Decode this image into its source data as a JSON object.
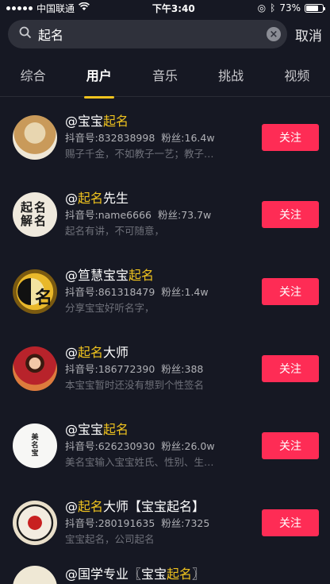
{
  "status_bar": {
    "carrier": "中国联通",
    "time": "下午3:40",
    "battery": "73%",
    "battery_level": 0.73
  },
  "search": {
    "query": "起名",
    "cancel_label": "取消"
  },
  "tabs": [
    {
      "label": "综合",
      "active": false
    },
    {
      "label": "用户",
      "active": true
    },
    {
      "label": "音乐",
      "active": false
    },
    {
      "label": "挑战",
      "active": false
    },
    {
      "label": "视频",
      "active": false
    }
  ],
  "users": [
    {
      "name_pre": "@宝宝",
      "name_hl": "起名",
      "name_post": "",
      "id_label": "抖音号:832838998",
      "fans_label": "粉丝:16.4w",
      "bio": "赐子千金，不如教子一艺；教子…",
      "avatar_text": "",
      "follow_label": "关注"
    },
    {
      "name_pre": "@",
      "name_hl": "起名",
      "name_post": "先生",
      "id_label": "抖音号:name6666",
      "fans_label": "粉丝:73.7w",
      "bio": "起名有讲，不可随意，",
      "avatar_text": "起名解名",
      "follow_label": "关注"
    },
    {
      "name_pre": "@笪慧宝宝",
      "name_hl": "起名",
      "name_post": "",
      "id_label": "抖音号:861318479",
      "fans_label": "粉丝:1.4w",
      "bio": "分享宝宝好听名字，",
      "avatar_text": "名",
      "follow_label": "关注"
    },
    {
      "name_pre": "@",
      "name_hl": "起名",
      "name_post": "大师",
      "id_label": "抖音号:186772390",
      "fans_label": "粉丝:388",
      "bio": "本宝宝暂时还没有想到个性签名",
      "avatar_text": "",
      "follow_label": "关注"
    },
    {
      "name_pre": "@宝宝",
      "name_hl": "起名",
      "name_post": "",
      "id_label": "抖音号:626230930",
      "fans_label": "粉丝:26.0w",
      "bio": "美名宝输入宝宝姓氏、性别、生…",
      "avatar_text": "美名宝",
      "follow_label": "关注"
    },
    {
      "name_pre": "@",
      "name_hl": "起名",
      "name_post": "大师【宝宝起名】",
      "id_label": "抖音号:280191635",
      "fans_label": "粉丝:7325",
      "bio": "宝宝起名，公司起名",
      "avatar_text": "",
      "follow_label": "关注"
    },
    {
      "name_pre": "@国学专业〖宝宝",
      "name_hl": "起名",
      "name_post": "〗",
      "id_label": "",
      "fans_label": "",
      "bio": "",
      "avatar_text": "",
      "follow_label": ""
    }
  ],
  "colors": {
    "background": "#161823",
    "accent_yellow": "#f0c31e",
    "follow_red": "#fe2c55"
  }
}
